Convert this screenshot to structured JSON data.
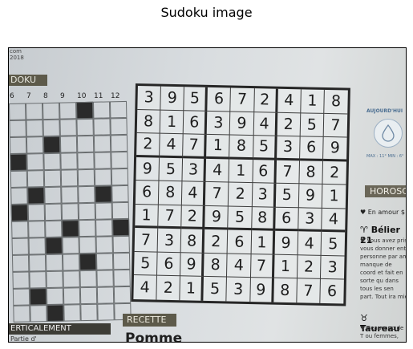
{
  "figure": {
    "title": "Sudoku image"
  },
  "newspaper": {
    "corner_text_1": "com",
    "corner_text_2": "2018",
    "section_banner": "DOKU",
    "column_numbers": [
      "6",
      "7",
      "8",
      "9",
      "10",
      "11",
      "12"
    ],
    "crossword_black_cells": [
      [
        0,
        4
      ],
      [
        2,
        2
      ],
      [
        3,
        0
      ],
      [
        5,
        1
      ],
      [
        5,
        5
      ],
      [
        6,
        0
      ],
      [
        7,
        3
      ],
      [
        7,
        6
      ],
      [
        8,
        2
      ],
      [
        9,
        4
      ],
      [
        11,
        1
      ],
      [
        12,
        2
      ]
    ],
    "sudoku": {
      "grid": [
        [
          "3",
          "9",
          "5",
          "6",
          "7",
          "2",
          "4",
          "1",
          "8"
        ],
        [
          "8",
          "1",
          "6",
          "3",
          "9",
          "4",
          "2",
          "5",
          "7"
        ],
        [
          "2",
          "4",
          "7",
          "1",
          "8",
          "5",
          "3",
          "6",
          "9"
        ],
        [
          "9",
          "5",
          "3",
          "4",
          "1",
          "6",
          "7",
          "8",
          "2"
        ],
        [
          "6",
          "8",
          "4",
          "7",
          "2",
          "3",
          "5",
          "9",
          "1"
        ],
        [
          "1",
          "7",
          "2",
          "9",
          "5",
          "8",
          "6",
          "3",
          "4"
        ],
        [
          "7",
          "3",
          "8",
          "2",
          "6",
          "1",
          "9",
          "4",
          "5"
        ],
        [
          "5",
          "6",
          "9",
          "8",
          "4",
          "7",
          "1",
          "2",
          "3"
        ],
        [
          "4",
          "2",
          "1",
          "5",
          "3",
          "9",
          "8",
          "7",
          "6"
        ]
      ]
    },
    "recette_label": "RECETTE",
    "recette_heading": "Pomme",
    "verticalement_label": "ERTICALEMENT",
    "verticalement_sub": "Partie d'",
    "weather_label": "AUJOURD'HUI",
    "weather_minmax": "MAX : 11° MIN : 6°",
    "horoscope_label": "HOROSCO",
    "en_amour": "♥ En amour  $",
    "belier_title": "♈ Bélier 21",
    "belier_text": "♥ Vous avez pris vous donner ent personne par am manque de coord et fait en sorte qu dans tous les sen part. Tout ira mie",
    "taureau_title": "♉ Taureau",
    "taureau_text": "♥ Beaucoup de T ou femmes, ose"
  },
  "colors": {
    "banner": "#5d5a4a",
    "grid_line": "#262626",
    "weather_blue": "#4b6e91"
  }
}
